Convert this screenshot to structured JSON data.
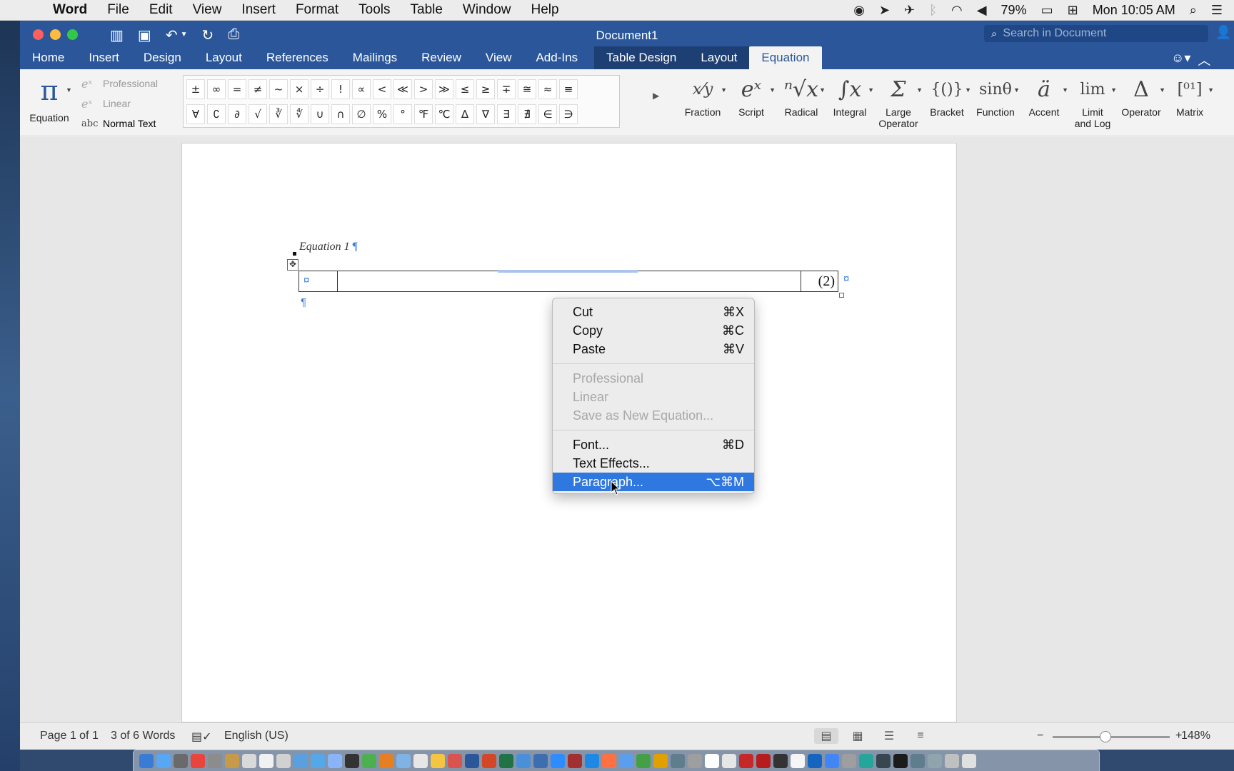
{
  "menubar": {
    "app": "Word",
    "items": [
      "File",
      "Edit",
      "View",
      "Insert",
      "Format",
      "Tools",
      "Table",
      "Window",
      "Help"
    ],
    "battery": "79%",
    "clock": "Mon 10:05 AM"
  },
  "window": {
    "title": "Document1",
    "search_placeholder": "Search in Document"
  },
  "tabs": {
    "home": "Home",
    "insert": "Insert",
    "design": "Design",
    "layout": "Layout",
    "references": "References",
    "mailings": "Mailings",
    "review": "Review",
    "view": "View",
    "addins": "Add-Ins",
    "table_design": "Table Design",
    "table_layout": "Layout",
    "equation": "Equation"
  },
  "ribbon": {
    "equation_label": "Equation",
    "mode_professional": "Professional",
    "mode_linear": "Linear",
    "mode_normal_text": "Normal Text",
    "symbols_row1": [
      "±",
      "∞",
      "=",
      "≠",
      "~",
      "×",
      "÷",
      "!",
      "∝",
      "<",
      "≪",
      ">",
      "≫",
      "≤",
      "≥",
      "∓",
      "≅",
      "≈",
      "≡"
    ],
    "symbols_row2": [
      "∀",
      "∁",
      "∂",
      "√",
      "∛",
      "∜",
      "∪",
      "∩",
      "∅",
      "%",
      "°",
      "℉",
      "℃",
      "∆",
      "∇",
      "∃",
      "∄",
      "∈",
      "∋"
    ],
    "structures": {
      "fraction": "Fraction",
      "script": "Script",
      "radical": "Radical",
      "integral": "Integral",
      "large_operator_1": "Large",
      "large_operator_2": "Operator",
      "bracket": "Bracket",
      "function": "Function",
      "accent": "Accent",
      "limit_log_1": "Limit",
      "limit_log_2": "and Log",
      "operator": "Operator",
      "matrix": "Matrix"
    }
  },
  "document": {
    "caption": "Equation 1",
    "equation_number": "(2)"
  },
  "context_menu": {
    "cut": "Cut",
    "cut_sc": "⌘X",
    "copy": "Copy",
    "copy_sc": "⌘C",
    "paste": "Paste",
    "paste_sc": "⌘V",
    "professional": "Professional",
    "linear": "Linear",
    "save_eq": "Save as New Equation...",
    "font": "Font...",
    "font_sc": "⌘D",
    "text_effects": "Text Effects...",
    "paragraph": "Paragraph...",
    "paragraph_sc": "⌥⌘M"
  },
  "status": {
    "page": "Page 1 of 1",
    "words": "3 of 6 Words",
    "language": "English (US)",
    "zoom": "148%"
  },
  "colors": {
    "accent": "#2b579a",
    "highlight": "#2f78e0"
  }
}
